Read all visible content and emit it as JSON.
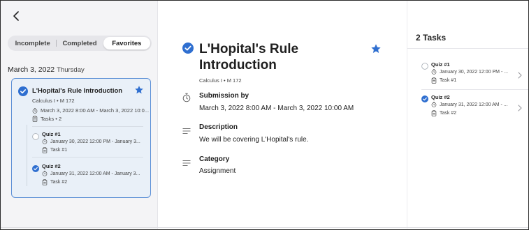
{
  "nav": {
    "back_icon": "chevron-left-icon"
  },
  "segments": [
    {
      "label": "Incomplete",
      "active": false
    },
    {
      "label": "Completed",
      "active": false
    },
    {
      "label": "Favorites",
      "active": true
    }
  ],
  "date_header": {
    "date": "March 3, 2022",
    "weekday": "Thursday"
  },
  "card": {
    "title": "L'Hopital's Rule Introduction",
    "course": "Calculus I • M 172",
    "datetime": "March 3, 2022 8:00 AM - March 3, 2022 10:0...",
    "tasks": "Tasks • 2",
    "subtasks": [
      {
        "title": "Quiz #1",
        "datetime": "January 30, 2022 12:00 PM - January 3...",
        "task": "Task #1",
        "completed": false
      },
      {
        "title": "Quiz #2",
        "datetime": "January 31, 2022 12:00 AM - January 3...",
        "task": "Task #2",
        "completed": true
      }
    ]
  },
  "detail": {
    "title": "L'Hopital's Rule Introduction",
    "course": "Calculus I • M 172",
    "submission_label": "Submission by",
    "submission_value": "March 3, 2022 8:00 AM - March 3, 2022 10:00 AM",
    "description_label": "Description",
    "description_value": "We will be covering L'Hopital's rule.",
    "category_label": "Category",
    "category_value": "Assignment"
  },
  "tasks_panel": {
    "heading": "2 Tasks",
    "items": [
      {
        "title": "Quiz #1",
        "datetime": "January 30, 2022 12:00 PM - ...",
        "task": "Task #1",
        "completed": false
      },
      {
        "title": "Quiz #2",
        "datetime": "January 31, 2022 12:00 AM - ...",
        "task": "Task #2",
        "completed": true
      }
    ]
  },
  "colors": {
    "accent": "#2f6fd0",
    "card_bg": "#e9f0f8",
    "card_border": "#5b8fd6"
  }
}
